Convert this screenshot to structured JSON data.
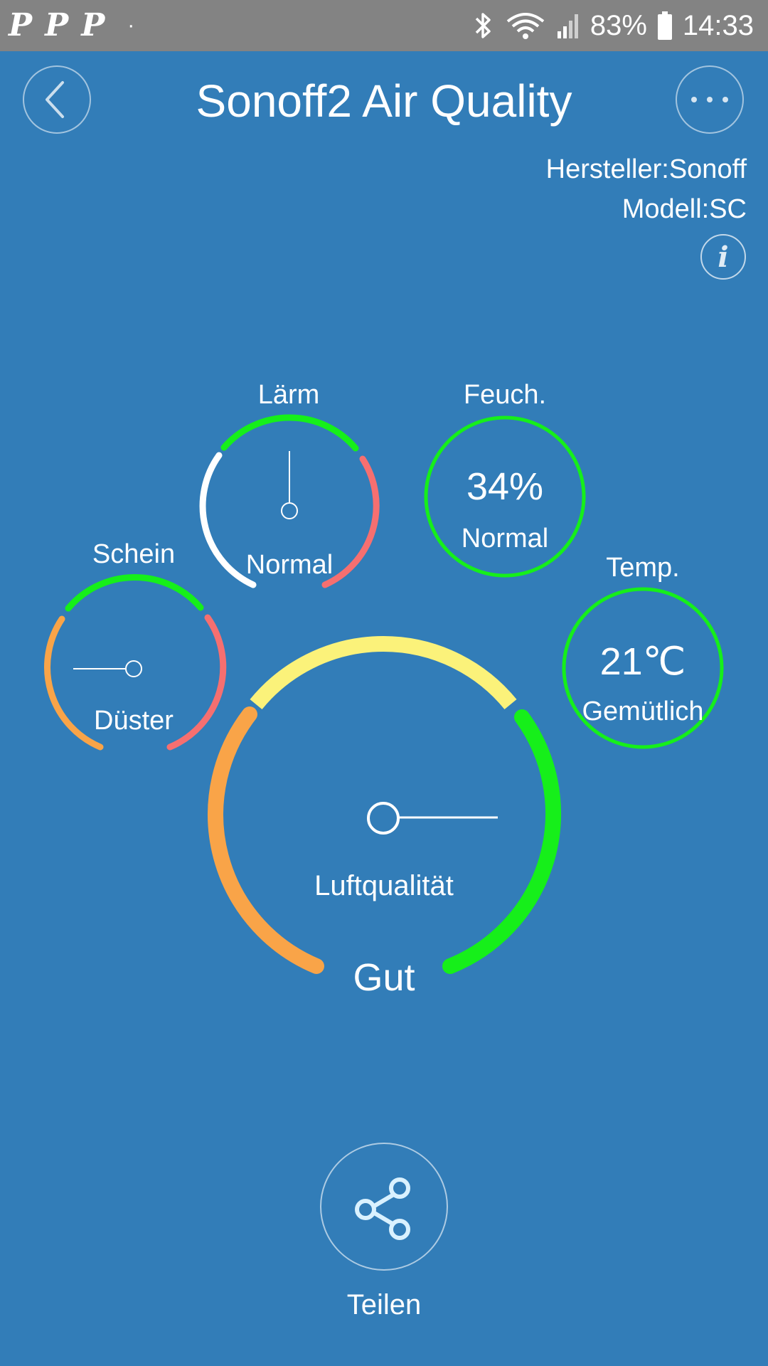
{
  "status_bar": {
    "notification_icons": [
      "P",
      "P",
      "P"
    ],
    "notification_dot": "·",
    "battery_percent": "83%",
    "time": "14:33"
  },
  "header": {
    "title": "Sonoff2 Air Quality",
    "manufacturer": "Hersteller:Sonoff",
    "model": "Modell:SC"
  },
  "gauges": {
    "noise": {
      "label": "Lärm",
      "status": "Normal"
    },
    "humidity": {
      "label": "Feuch.",
      "value": "34%",
      "status": "Normal"
    },
    "light": {
      "label": "Schein",
      "status": "Düster"
    },
    "temperature": {
      "label": "Temp.",
      "value": "21℃",
      "status": "Gemütlich"
    },
    "air_quality": {
      "label": "Luftqualität",
      "status": "Gut"
    }
  },
  "actions": {
    "share_label": "Teilen"
  },
  "colors": {
    "background": "#327db8",
    "status_bar": "#838383",
    "green": "#16ef1a",
    "yellow": "#fbf27a",
    "orange": "#f9a448",
    "red": "#f66f70"
  }
}
